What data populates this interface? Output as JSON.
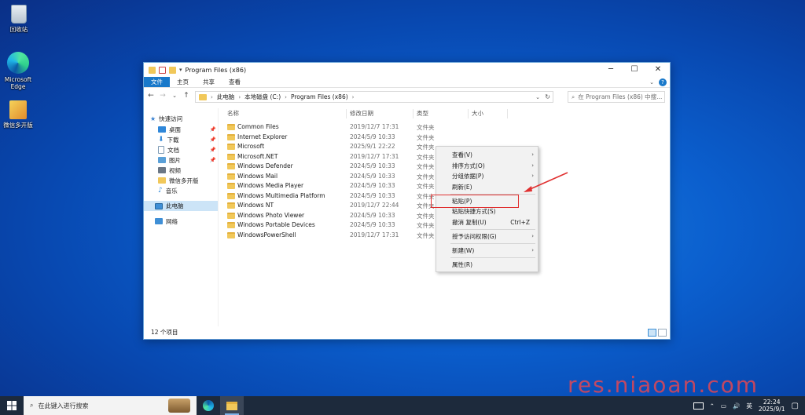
{
  "desktop": {
    "icons": [
      {
        "label": "回收站"
      },
      {
        "label": "Microsoft Edge"
      },
      {
        "label": "微信多开版"
      }
    ]
  },
  "window": {
    "title": "Program Files (x86)",
    "ribbon_tabs": [
      "文件",
      "主页",
      "共享",
      "查看"
    ],
    "help": "?",
    "breadcrumb": [
      "此电脑",
      "本地磁盘 (C:)",
      "Program Files (x86)"
    ],
    "search_placeholder": "在 Program Files (x86) 中搜...",
    "nav": [
      {
        "label": "快速访问",
        "icon": "star-icon"
      },
      {
        "label": "桌面",
        "icon": "desktop-icon",
        "pinned": true
      },
      {
        "label": "下载",
        "icon": "download-icon",
        "pinned": true
      },
      {
        "label": "文档",
        "icon": "document-icon",
        "pinned": true
      },
      {
        "label": "图片",
        "icon": "picture-icon",
        "pinned": true
      },
      {
        "label": "视频",
        "icon": "video-icon"
      },
      {
        "label": "微信多开版",
        "icon": "folder-icon"
      },
      {
        "label": "音乐",
        "icon": "music-icon"
      },
      {
        "label": "此电脑",
        "icon": "computer-icon"
      },
      {
        "label": "网络",
        "icon": "network-icon"
      }
    ],
    "columns": [
      "名称",
      "修改日期",
      "类型",
      "大小"
    ],
    "files": [
      {
        "name": "Common Files",
        "date": "2019/12/7 17:31",
        "type": "文件夹"
      },
      {
        "name": "Internet Explorer",
        "date": "2024/5/9 10:33",
        "type": "文件夹"
      },
      {
        "name": "Microsoft",
        "date": "2025/9/1 22:22",
        "type": "文件夹"
      },
      {
        "name": "Microsoft.NET",
        "date": "2019/12/7 17:31",
        "type": "文件夹"
      },
      {
        "name": "Windows Defender",
        "date": "2024/5/9 10:33",
        "type": "文件夹"
      },
      {
        "name": "Windows Mail",
        "date": "2024/5/9 10:33",
        "type": "文件夹"
      },
      {
        "name": "Windows Media Player",
        "date": "2024/5/9 10:33",
        "type": "文件夹"
      },
      {
        "name": "Windows Multimedia Platform",
        "date": "2024/5/9 10:33",
        "type": "文件夹"
      },
      {
        "name": "Windows NT",
        "date": "2019/12/7 22:44",
        "type": "文件夹"
      },
      {
        "name": "Windows Photo Viewer",
        "date": "2024/5/9 10:33",
        "type": "文件夹"
      },
      {
        "name": "Windows Portable Devices",
        "date": "2024/5/9 10:33",
        "type": "文件夹"
      },
      {
        "name": "WindowsPowerShell",
        "date": "2019/12/7 17:31",
        "type": "文件夹"
      }
    ],
    "status": "12 个项目"
  },
  "context_menu": {
    "items": [
      {
        "label": "查看(V)",
        "submenu": true
      },
      {
        "label": "排序方式(O)",
        "submenu": true
      },
      {
        "label": "分组依据(P)",
        "submenu": true
      },
      {
        "label": "刷新(E)"
      },
      {
        "label": "粘贴(P)"
      },
      {
        "label": "粘贴快捷方式(S)"
      },
      {
        "label": "撤消 复制(U)",
        "shortcut": "Ctrl+Z"
      },
      {
        "label": "授予访问权限(G)",
        "submenu": true
      },
      {
        "label": "新建(W)",
        "submenu": true
      },
      {
        "label": "属性(R)"
      }
    ],
    "highlight_color": "#e03030"
  },
  "taskbar": {
    "search_placeholder": "在此键入进行搜索",
    "ime": "英",
    "time": "22:24",
    "date": "2025/9/1"
  },
  "watermark": "res.niaoan.com",
  "colors": {
    "accent": "#1979ca",
    "selection": "#cce4f7"
  }
}
